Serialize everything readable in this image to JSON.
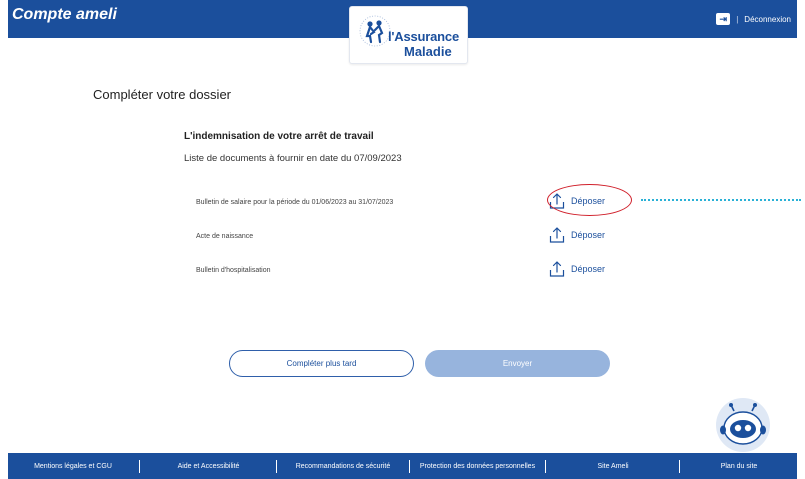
{
  "header": {
    "app_title": "Compte ameli",
    "logout_label": "Déconnexion",
    "logo_line1": "l'Assurance",
    "logo_line2": "Maladie"
  },
  "main": {
    "page_title": "Compléter votre dossier",
    "section_title": "L'indemnisation de votre arrêt de travail",
    "section_subtitle": "Liste de documents à fournir en date du 07/09/2023",
    "documents": [
      {
        "label": "Bulletin de salaire pour la période du 01/06/2023 au 31/07/2023",
        "action": "Déposer",
        "highlighted": true
      },
      {
        "label": "Acte de naissance",
        "action": "Déposer"
      },
      {
        "label": "Bulletin d'hospitalisation",
        "action": "Déposer"
      }
    ],
    "btn_later": "Compléter plus tard",
    "btn_send": "Envoyer"
  },
  "footer": {
    "links": [
      "Mentions légales et CGU",
      "Aide et Accessibilité",
      "Recommandations de sécurité",
      "Protection des données personnelles",
      "Site Ameli",
      "Plan du site"
    ]
  },
  "colors": {
    "brand": "#1b4f9c",
    "send_disabled": "#97b4dd",
    "highlight": "#d0202b",
    "pointer_line": "#2ab1d6"
  }
}
